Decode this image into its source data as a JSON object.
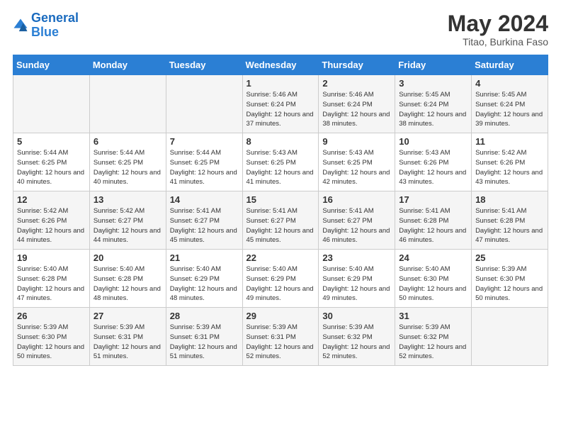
{
  "header": {
    "logo_line1": "General",
    "logo_line2": "Blue",
    "month_title": "May 2024",
    "subtitle": "Titao, Burkina Faso"
  },
  "weekdays": [
    "Sunday",
    "Monday",
    "Tuesday",
    "Wednesday",
    "Thursday",
    "Friday",
    "Saturday"
  ],
  "weeks": [
    [
      {
        "day": "",
        "info": ""
      },
      {
        "day": "",
        "info": ""
      },
      {
        "day": "",
        "info": ""
      },
      {
        "day": "1",
        "info": "Sunrise: 5:46 AM\nSunset: 6:24 PM\nDaylight: 12 hours\nand 37 minutes."
      },
      {
        "day": "2",
        "info": "Sunrise: 5:46 AM\nSunset: 6:24 PM\nDaylight: 12 hours\nand 38 minutes."
      },
      {
        "day": "3",
        "info": "Sunrise: 5:45 AM\nSunset: 6:24 PM\nDaylight: 12 hours\nand 38 minutes."
      },
      {
        "day": "4",
        "info": "Sunrise: 5:45 AM\nSunset: 6:24 PM\nDaylight: 12 hours\nand 39 minutes."
      }
    ],
    [
      {
        "day": "5",
        "info": "Sunrise: 5:44 AM\nSunset: 6:25 PM\nDaylight: 12 hours\nand 40 minutes."
      },
      {
        "day": "6",
        "info": "Sunrise: 5:44 AM\nSunset: 6:25 PM\nDaylight: 12 hours\nand 40 minutes."
      },
      {
        "day": "7",
        "info": "Sunrise: 5:44 AM\nSunset: 6:25 PM\nDaylight: 12 hours\nand 41 minutes."
      },
      {
        "day": "8",
        "info": "Sunrise: 5:43 AM\nSunset: 6:25 PM\nDaylight: 12 hours\nand 41 minutes."
      },
      {
        "day": "9",
        "info": "Sunrise: 5:43 AM\nSunset: 6:25 PM\nDaylight: 12 hours\nand 42 minutes."
      },
      {
        "day": "10",
        "info": "Sunrise: 5:43 AM\nSunset: 6:26 PM\nDaylight: 12 hours\nand 43 minutes."
      },
      {
        "day": "11",
        "info": "Sunrise: 5:42 AM\nSunset: 6:26 PM\nDaylight: 12 hours\nand 43 minutes."
      }
    ],
    [
      {
        "day": "12",
        "info": "Sunrise: 5:42 AM\nSunset: 6:26 PM\nDaylight: 12 hours\nand 44 minutes."
      },
      {
        "day": "13",
        "info": "Sunrise: 5:42 AM\nSunset: 6:27 PM\nDaylight: 12 hours\nand 44 minutes."
      },
      {
        "day": "14",
        "info": "Sunrise: 5:41 AM\nSunset: 6:27 PM\nDaylight: 12 hours\nand 45 minutes."
      },
      {
        "day": "15",
        "info": "Sunrise: 5:41 AM\nSunset: 6:27 PM\nDaylight: 12 hours\nand 45 minutes."
      },
      {
        "day": "16",
        "info": "Sunrise: 5:41 AM\nSunset: 6:27 PM\nDaylight: 12 hours\nand 46 minutes."
      },
      {
        "day": "17",
        "info": "Sunrise: 5:41 AM\nSunset: 6:28 PM\nDaylight: 12 hours\nand 46 minutes."
      },
      {
        "day": "18",
        "info": "Sunrise: 5:41 AM\nSunset: 6:28 PM\nDaylight: 12 hours\nand 47 minutes."
      }
    ],
    [
      {
        "day": "19",
        "info": "Sunrise: 5:40 AM\nSunset: 6:28 PM\nDaylight: 12 hours\nand 47 minutes."
      },
      {
        "day": "20",
        "info": "Sunrise: 5:40 AM\nSunset: 6:28 PM\nDaylight: 12 hours\nand 48 minutes."
      },
      {
        "day": "21",
        "info": "Sunrise: 5:40 AM\nSunset: 6:29 PM\nDaylight: 12 hours\nand 48 minutes."
      },
      {
        "day": "22",
        "info": "Sunrise: 5:40 AM\nSunset: 6:29 PM\nDaylight: 12 hours\nand 49 minutes."
      },
      {
        "day": "23",
        "info": "Sunrise: 5:40 AM\nSunset: 6:29 PM\nDaylight: 12 hours\nand 49 minutes."
      },
      {
        "day": "24",
        "info": "Sunrise: 5:40 AM\nSunset: 6:30 PM\nDaylight: 12 hours\nand 50 minutes."
      },
      {
        "day": "25",
        "info": "Sunrise: 5:39 AM\nSunset: 6:30 PM\nDaylight: 12 hours\nand 50 minutes."
      }
    ],
    [
      {
        "day": "26",
        "info": "Sunrise: 5:39 AM\nSunset: 6:30 PM\nDaylight: 12 hours\nand 50 minutes."
      },
      {
        "day": "27",
        "info": "Sunrise: 5:39 AM\nSunset: 6:31 PM\nDaylight: 12 hours\nand 51 minutes."
      },
      {
        "day": "28",
        "info": "Sunrise: 5:39 AM\nSunset: 6:31 PM\nDaylight: 12 hours\nand 51 minutes."
      },
      {
        "day": "29",
        "info": "Sunrise: 5:39 AM\nSunset: 6:31 PM\nDaylight: 12 hours\nand 52 minutes."
      },
      {
        "day": "30",
        "info": "Sunrise: 5:39 AM\nSunset: 6:32 PM\nDaylight: 12 hours\nand 52 minutes."
      },
      {
        "day": "31",
        "info": "Sunrise: 5:39 AM\nSunset: 6:32 PM\nDaylight: 12 hours\nand 52 minutes."
      },
      {
        "day": "",
        "info": ""
      }
    ]
  ]
}
